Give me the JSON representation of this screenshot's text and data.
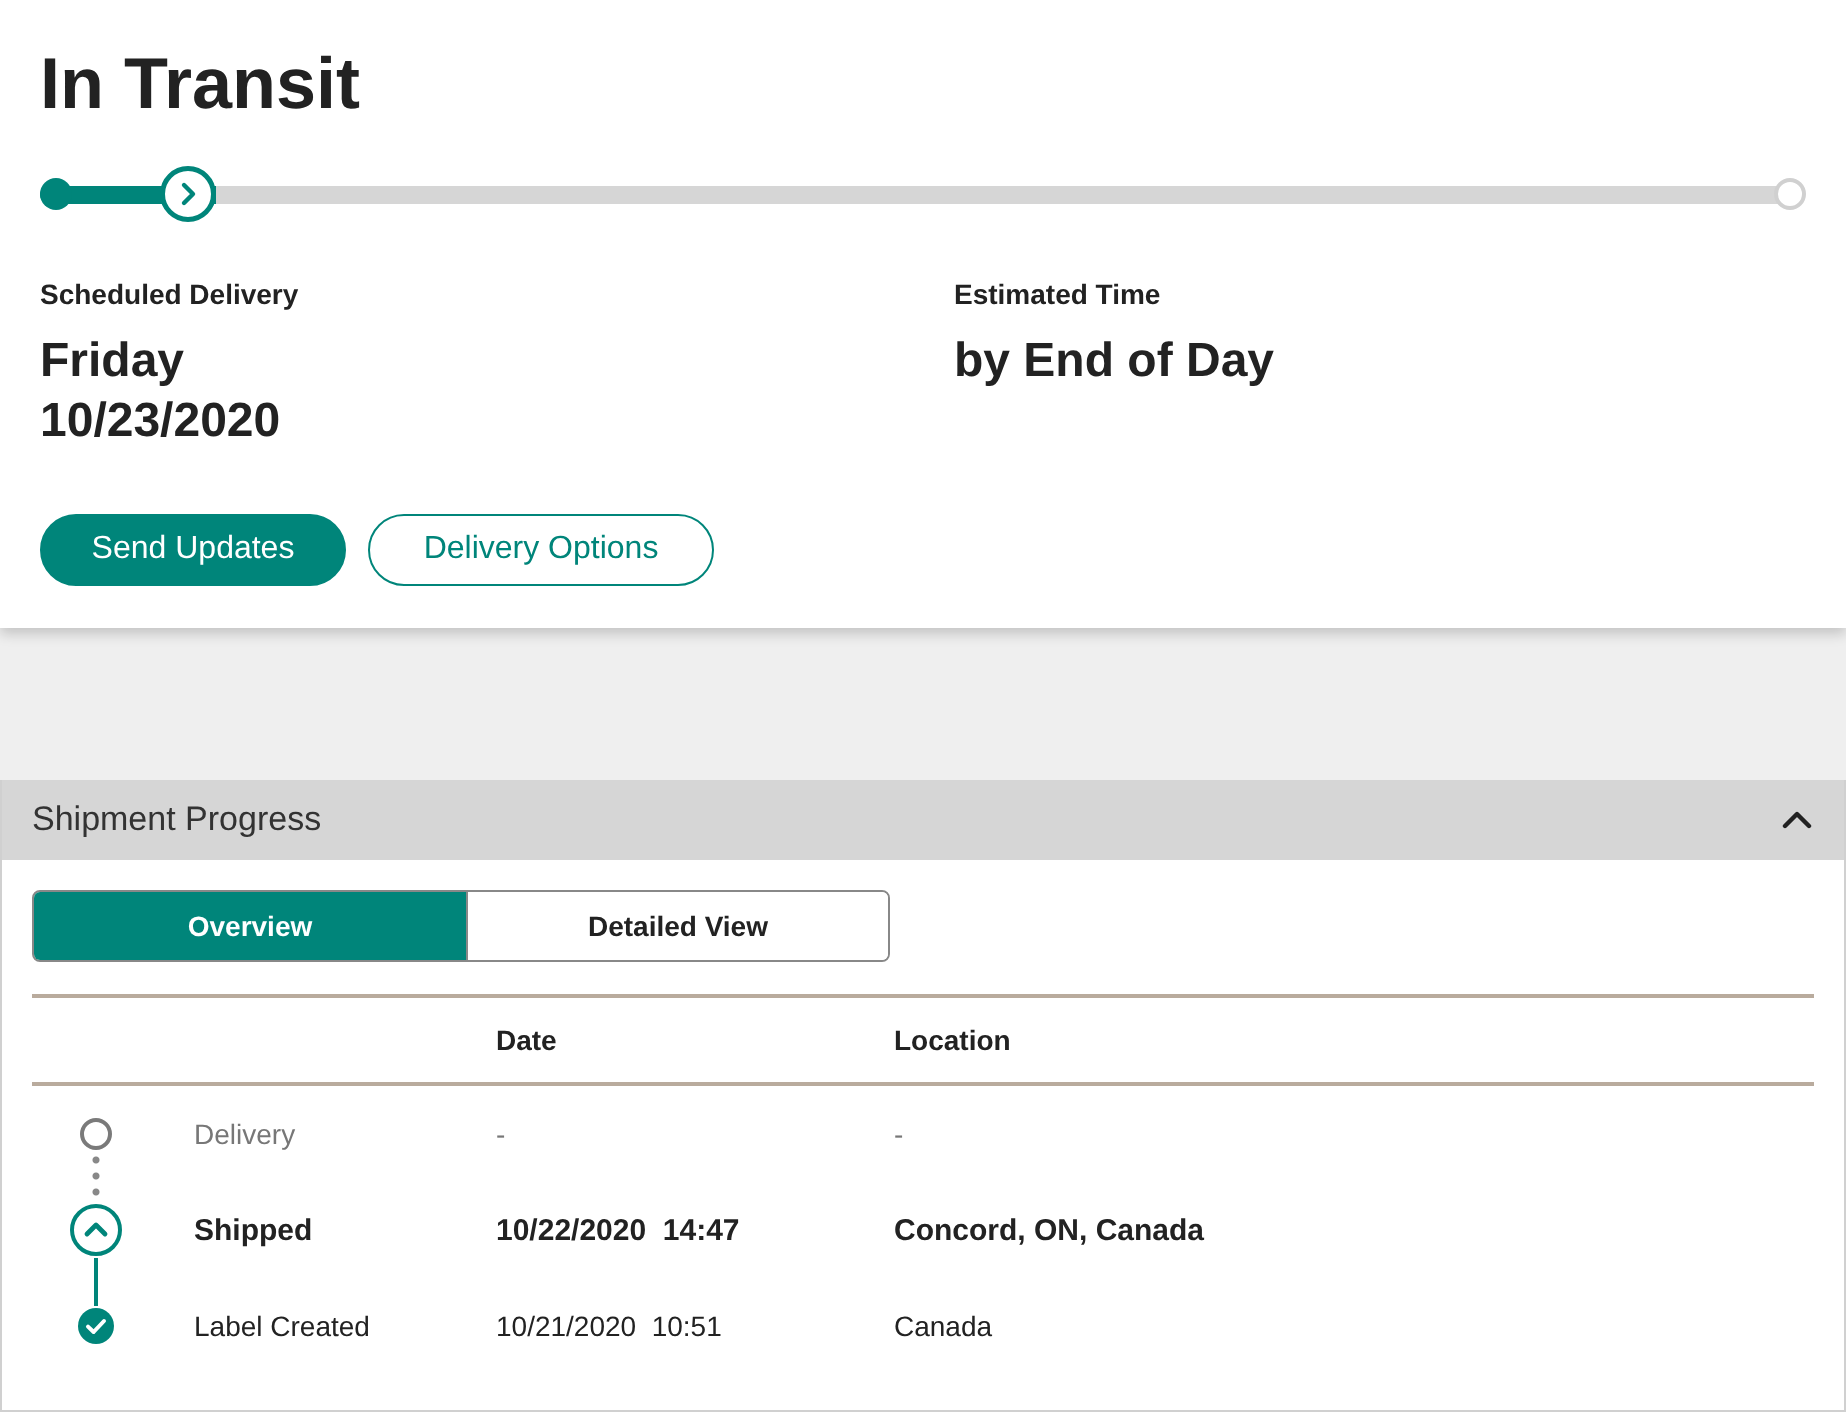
{
  "status": {
    "title": "In Transit"
  },
  "progress": {
    "level": 0.1
  },
  "details": [
    {
      "label": "Scheduled Delivery",
      "lines": [
        "Friday",
        "10/23/2020"
      ]
    },
    {
      "label": "Estimated Time",
      "lines": [
        "by End of Day"
      ]
    }
  ],
  "buttons": [
    {
      "label": "Send Updates",
      "kind": "primary"
    },
    {
      "label": "Delivery Options",
      "kind": "secondary"
    }
  ],
  "shipment_progress": {
    "title": "Shipment Progress",
    "expanded": true,
    "views": [
      {
        "label": "Overview",
        "selected": true
      },
      {
        "label": "Detailed View",
        "selected": false
      }
    ],
    "columns": [
      "Date",
      "Location"
    ],
    "events": [
      {
        "kind": "pending",
        "event": "Delivery",
        "date": "-",
        "location": "-"
      },
      {
        "kind": "current",
        "event": "Shipped",
        "date": "10/22/2020  14:47",
        "location": "Concord, ON, Canada"
      },
      {
        "kind": "done",
        "event": "Label Created",
        "date": "10/21/2020  10:51",
        "location": "Canada"
      }
    ]
  }
}
